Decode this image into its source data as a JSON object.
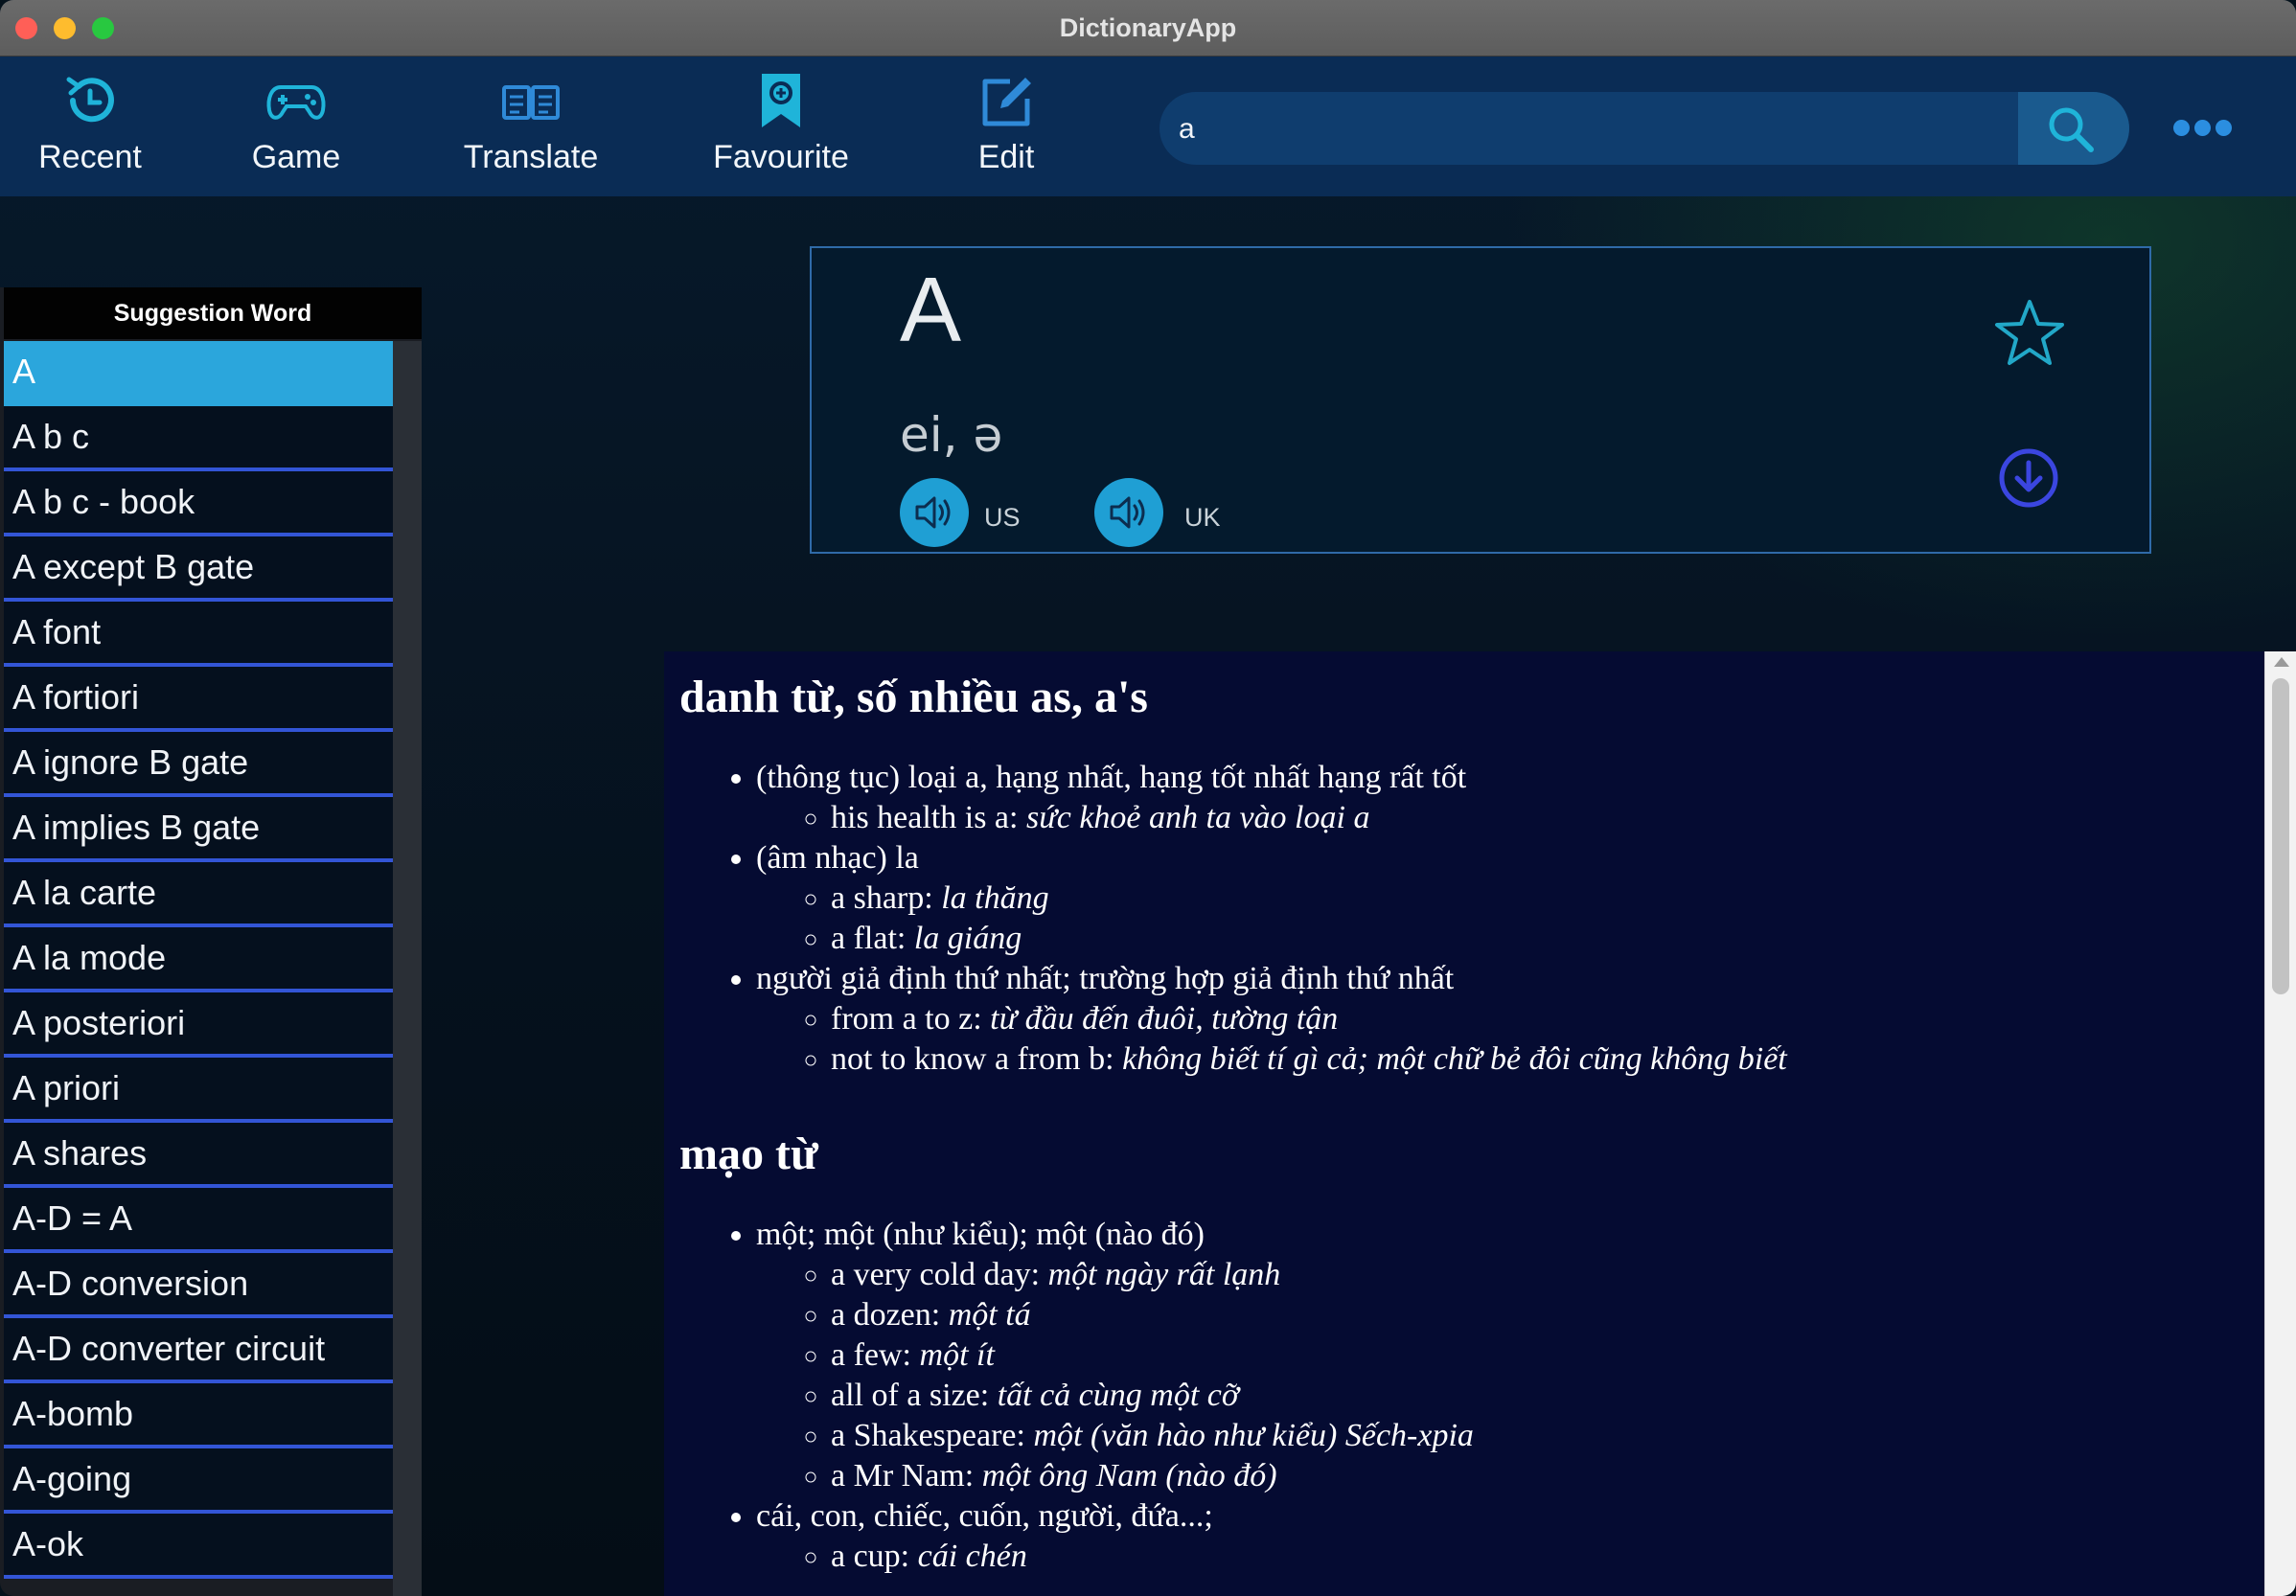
{
  "window": {
    "title": "DictionaryApp"
  },
  "toolbar": {
    "items": [
      {
        "label": "Recent",
        "icon": "clock-history-icon"
      },
      {
        "label": "Game",
        "icon": "gamepad-icon"
      },
      {
        "label": "Translate",
        "icon": "translate-icon"
      },
      {
        "label": "Favourite",
        "icon": "bookmark-icon"
      },
      {
        "label": "Edit",
        "icon": "edit-icon"
      }
    ],
    "search": {
      "value": "a",
      "icon": "search-icon"
    },
    "more_icon": "more-dots-icon"
  },
  "sidebar": {
    "title": "Suggestion Word",
    "items": [
      "A",
      "A b c",
      "A b c - book",
      "A except B gate",
      "A font",
      "A fortiori",
      "A ignore B gate",
      "A implies B gate",
      "A la carte",
      "A la mode",
      "A posteriori",
      "A priori",
      "A shares",
      "A-D = A",
      "A-D conversion",
      "A-D converter circuit",
      "A-bomb",
      "A-going",
      "A-ok"
    ],
    "selected": "A"
  },
  "entry": {
    "word": "A",
    "phonetic": "ei, ə",
    "us_label": "US",
    "uk_label": "UK"
  },
  "definition": {
    "sections": [
      {
        "heading": "danh từ, số nhiều as, a's",
        "senses": [
          {
            "text": "(thông tục) loại a, hạng nhất, hạng tốt nhất hạng rất tốt",
            "examples": [
              {
                "en": "his health is a:",
                "vi": "sức khoẻ anh ta vào loại a"
              }
            ]
          },
          {
            "text": "(âm nhạc) la",
            "examples": [
              {
                "en": "a sharp:",
                "vi": "la thăng"
              },
              {
                "en": "a flat:",
                "vi": "la giáng"
              }
            ]
          },
          {
            "text": "người giả định thứ nhất; trường hợp giả định thứ nhất",
            "examples": [
              {
                "en": "from a to z:",
                "vi": "từ đầu đến đuôi, tường tận"
              },
              {
                "en": "not to know a from b:",
                "vi": "không biết tí gì cả; một chữ bẻ đôi cũng không biết"
              }
            ]
          }
        ]
      },
      {
        "heading": "mạo từ",
        "senses": [
          {
            "text": "một; một (như kiểu); một (nào đó)",
            "examples": [
              {
                "en": "a very cold day:",
                "vi": "một ngày rất lạnh"
              },
              {
                "en": "a dozen:",
                "vi": "một tá"
              },
              {
                "en": "a few:",
                "vi": "một ít"
              },
              {
                "en": "all of a size:",
                "vi": "tất cả cùng một cỡ"
              },
              {
                "en": "a Shakespeare:",
                "vi": "một (văn hào như kiểu) Sếch-xpia"
              },
              {
                "en": "a Mr Nam:",
                "vi": "một ông Nam (nào đó)"
              }
            ]
          },
          {
            "text": "cái, con, chiếc, cuốn, người, đứa...;",
            "examples": [
              {
                "en": "a cup:",
                "vi": "cái chén"
              }
            ]
          }
        ]
      }
    ]
  }
}
